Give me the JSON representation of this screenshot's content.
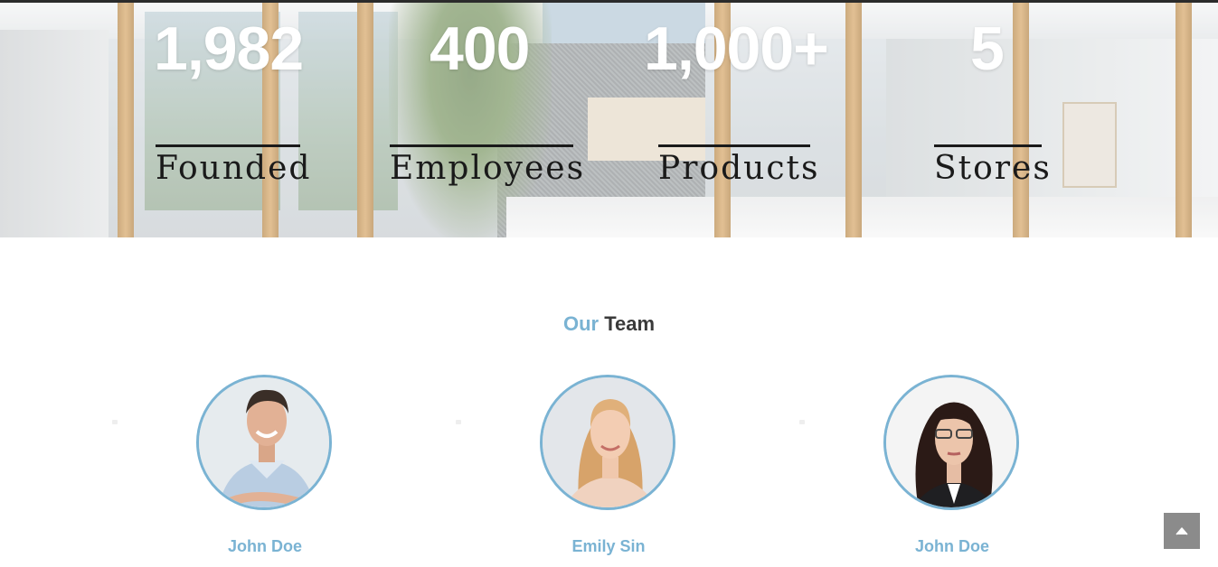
{
  "stats": [
    {
      "number": "1,982",
      "label": "Founded"
    },
    {
      "number": "400",
      "label": "Employees"
    },
    {
      "number": "1,000+",
      "label": "Products"
    },
    {
      "number": "5",
      "label": "Stores"
    }
  ],
  "team": {
    "title_accent": "Our",
    "title_rest": "Team",
    "members": [
      {
        "name": "John Doe"
      },
      {
        "name": "Emily Sin"
      },
      {
        "name": "John Doe"
      }
    ]
  },
  "colors": {
    "accent": "#7ab3d3",
    "dark_text": "#3a3a3a",
    "stat_number": "#ffffff",
    "stat_label": "#1a1a1a",
    "back_to_top_bg": "#8b8b8b"
  },
  "icons": {
    "back_to_top": "chevron-up-icon"
  }
}
